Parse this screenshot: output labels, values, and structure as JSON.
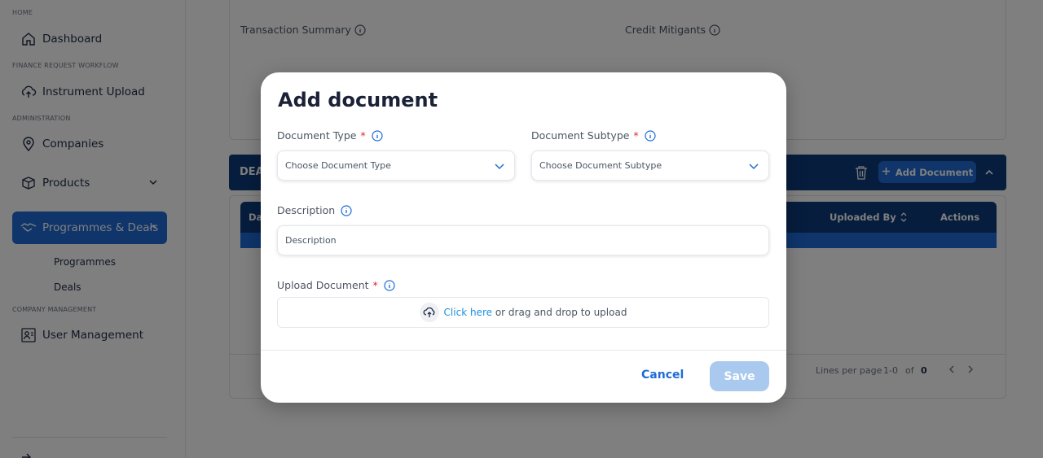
{
  "sidebar": {
    "sections": {
      "home": "HOME",
      "finance": "FINANCE REQUEST WORKFLOW",
      "admin": "ADMINISTRATION",
      "company": "COMPANY MANAGEMENT"
    },
    "items": {
      "dashboard": "Dashboard",
      "instrument_upload": "Instrument Upload",
      "companies": "Companies",
      "products": "Products",
      "programmes_deals": "Programmes & Deals",
      "programmes": "Programmes",
      "deals": "Deals",
      "user_management": "User Management"
    }
  },
  "main": {
    "transaction_summary": "Transaction Summary",
    "credit_mitigants": "Credit Mitigants",
    "deals_bar_title": "DEA",
    "add_document_label": "Add Document",
    "table": {
      "col_first": "Da",
      "col_uploaded_by": "Uploaded By",
      "col_actions": "Actions"
    },
    "pager": {
      "lines_per_page": "Lines per page",
      "range": "1-0",
      "of": "of",
      "total": "0"
    }
  },
  "modal": {
    "title": "Add document",
    "document_type": {
      "label": "Document Type",
      "placeholder": "Choose Document Type"
    },
    "document_subtype": {
      "label": "Document Subtype",
      "placeholder": "Choose Document Subtype"
    },
    "description": {
      "label": "Description",
      "placeholder": "Description"
    },
    "upload": {
      "label": "Upload Document",
      "link": "Click here",
      "rest": "or drag and drop to upload"
    },
    "cancel": "Cancel",
    "save": "Save"
  },
  "colors": {
    "primary": "#1e6bd6",
    "navy": "#0d3a7a",
    "save_disabled": "#a9c9ef",
    "required": "#e02424"
  }
}
